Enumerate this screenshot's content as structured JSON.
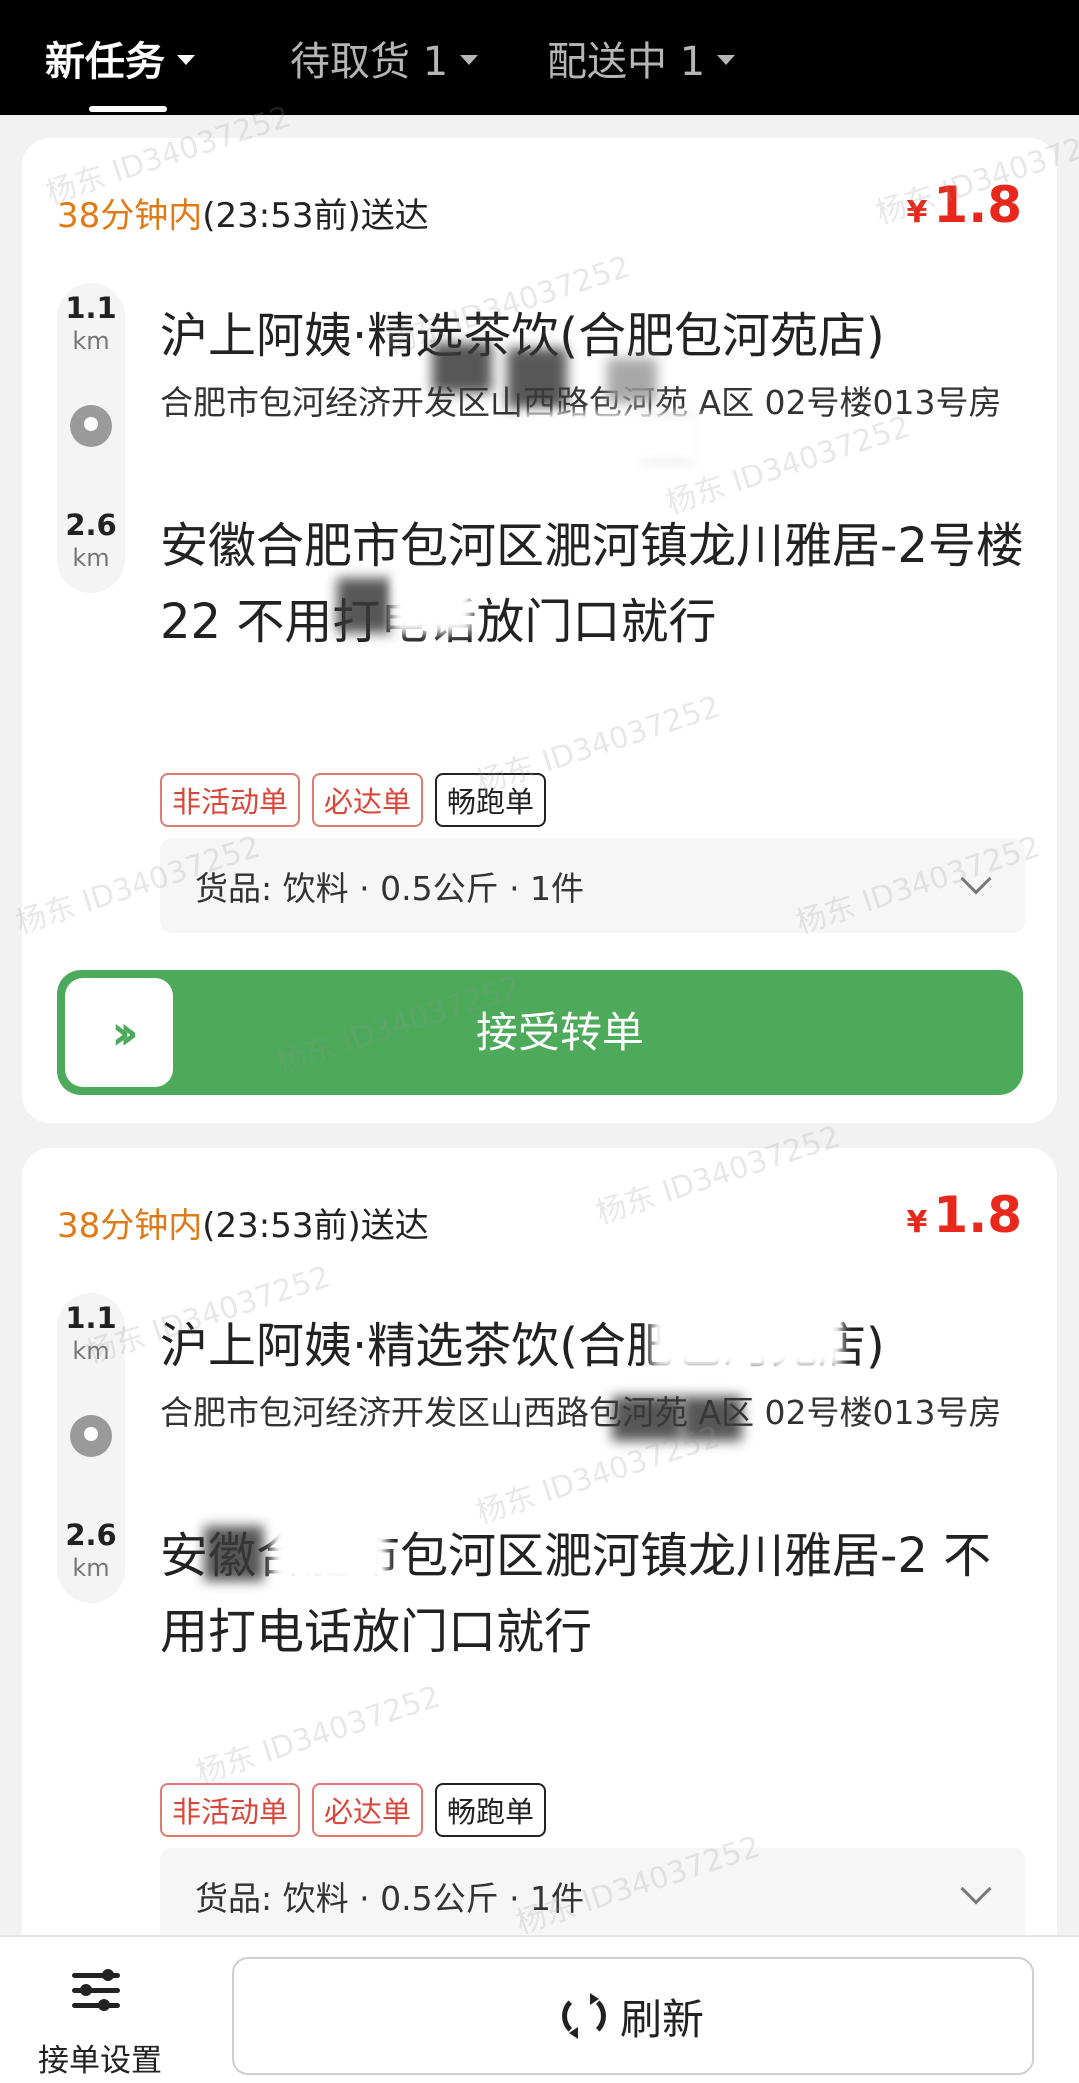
{
  "tabs": [
    {
      "label": "新任务",
      "active": true
    },
    {
      "label": "待取货 1",
      "active": false
    },
    {
      "label": "配送中 1",
      "active": false
    }
  ],
  "orders": [
    {
      "deadline_highlight": "38分钟内",
      "deadline_rest": "(23:53前)送达",
      "currency": "¥",
      "price": "1.8",
      "pickup_distance_value": "1.1",
      "pickup_distance_unit": "km",
      "delivery_distance_value": "2.6",
      "delivery_distance_unit": "km",
      "store_name": "沪上阿姨·精选茶饮(合肥包河苑店)",
      "store_address": "合肥市包河经济开发区山西路包河苑 A区 02号楼013号房",
      "destination": "安徽合肥市包河区淝河镇龙川雅居-2号楼22 不用打电话放门口就行",
      "tags": [
        "非活动单",
        "必达单",
        "畅跑单"
      ],
      "goods_label": "货品:",
      "goods_detail": "饮料 · 0.5公斤 · 1件",
      "action": "接受转单"
    },
    {
      "deadline_highlight": "38分钟内",
      "deadline_rest": "(23:53前)送达",
      "currency": "¥",
      "price": "1.8",
      "pickup_distance_value": "1.1",
      "pickup_distance_unit": "km",
      "delivery_distance_value": "2.6",
      "delivery_distance_unit": "km",
      "store_name": "沪上阿姨·精选茶饮(合肥包河苑店)",
      "store_address": "合肥市包河经济开发区山西路包河苑 A区 02号楼013号房",
      "destination": "安徽合肥市包河区淝河镇龙川雅居-2 不用打电话放门口就行",
      "tags": [
        "非活动单",
        "必达单",
        "畅跑单"
      ],
      "goods_label": "货品:",
      "goods_detail": "饮料 · 0.5公斤 · 1件"
    }
  ],
  "watermark": "杨东 ID34037252",
  "bottom": {
    "settings_label": "接单设置",
    "refresh_label": "刷新"
  },
  "colors": {
    "accent_orange": "#e07a16",
    "price_red": "#e8281c",
    "accept_green": "#4caa5a"
  }
}
